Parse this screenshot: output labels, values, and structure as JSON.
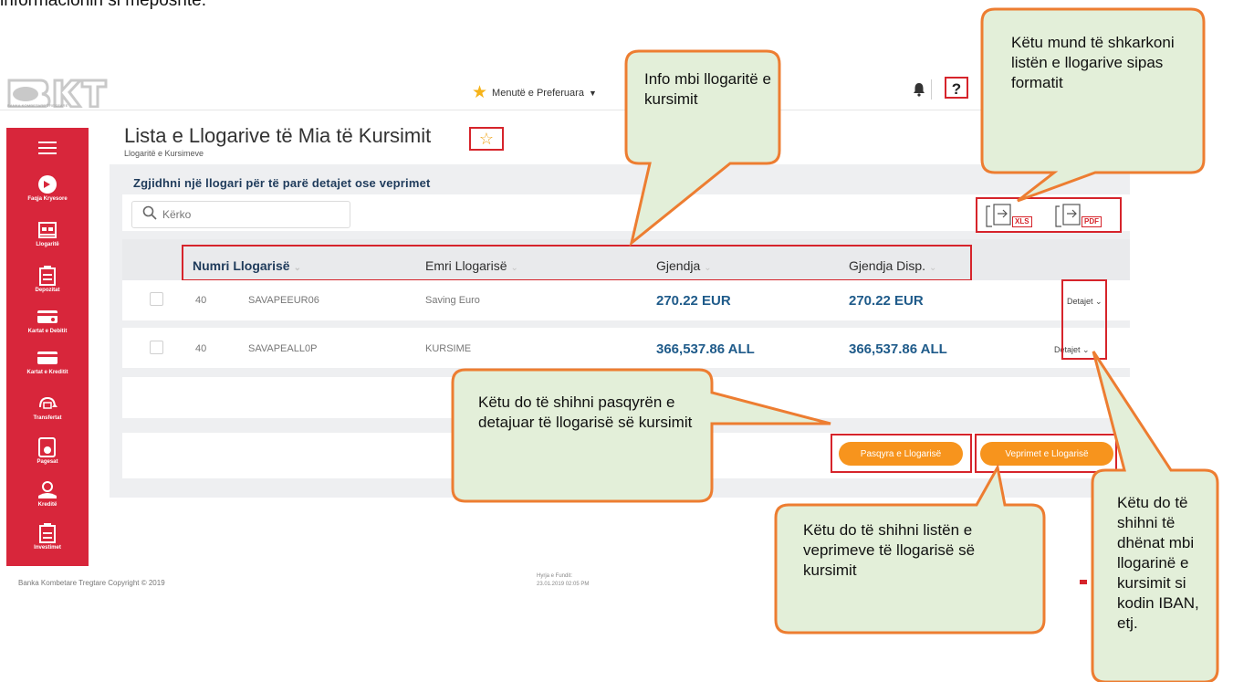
{
  "intro_text": "informacionin si méposhte.",
  "header": {
    "logo_text": "BANKA KOMBETARE TREGTARE",
    "favorites_label": "Menutë e Preferuara",
    "help_label": "?"
  },
  "sidebar": {
    "items": [
      {
        "label": "",
        "icon": "menu-icon"
      },
      {
        "label": "Faqja Kryesore",
        "icon": "home-icon"
      },
      {
        "label": "Llogaritë",
        "icon": "accounts-icon"
      },
      {
        "label": "Depozitat",
        "icon": "deposits-icon"
      },
      {
        "label": "Kartat e Debitit",
        "icon": "debit-card-icon"
      },
      {
        "label": "Kartat e Kreditit",
        "icon": "credit-card-icon"
      },
      {
        "label": "Transfertat",
        "icon": "transfer-icon"
      },
      {
        "label": "Pagesat",
        "icon": "payments-icon"
      },
      {
        "label": "Kreditë",
        "icon": "loans-icon"
      },
      {
        "label": "Investimet",
        "icon": "investments-icon"
      }
    ]
  },
  "page": {
    "title": "Lista e Llogarive të Mia të Kursimit",
    "breadcrumb": "Llogaritë e Kursimeve",
    "instruction": "Zgjidhni një llogari për të parë detajet ose veprimet",
    "search_placeholder": "Kërko",
    "export_xls": "XLS",
    "export_pdf": "PDF"
  },
  "table": {
    "headers": [
      "Numri Llogarisë",
      "Emri Llogarisë",
      "Gjendja",
      "Gjendja Disp."
    ],
    "rows": [
      {
        "number": "40",
        "code": "SAVAPEEUR06",
        "name": "Saving Euro",
        "balance": "270.22 EUR",
        "available": "270.22 EUR",
        "details": "Detajet ⌄"
      },
      {
        "number": "40",
        "code": "SAVAPEALL0P",
        "name": "KURSIME",
        "balance": "366,537.86 ALL",
        "available": "366,537.86 ALL",
        "details": "Detajet ⌄"
      }
    ]
  },
  "buttons": {
    "statement": "Pasqyra e Llogarisë",
    "transactions": "Veprimet e Llogarisë"
  },
  "footer": {
    "copyright": "Banka Kombetare Tregtare Copyright © 2019",
    "last_login_label": "Hyrja e Fundit:",
    "last_login_value": "23.01.2019 02:05 PM"
  },
  "callouts": {
    "info": "Info mbi llogaritë e kursimit",
    "export": "Këtu mund të shkarkoni listën e llogarive sipas formatit",
    "statement": "Këtu do të shihni pasqyrën e detajuar të llogarisë së kursimit",
    "transactions": "Këtu do të shihni listën e veprimeve të llogarisë së kursimit",
    "details": "Këtu do të shihni të dhënat mbi llogarinë e kursimit si kodin IBAN, etj."
  },
  "colors": {
    "brand_red": "#d8263b",
    "accent_orange": "#f7941d",
    "callout_fill": "#e3efd9",
    "callout_border": "#ed7d31",
    "amount_blue": "#1f5b8a"
  }
}
